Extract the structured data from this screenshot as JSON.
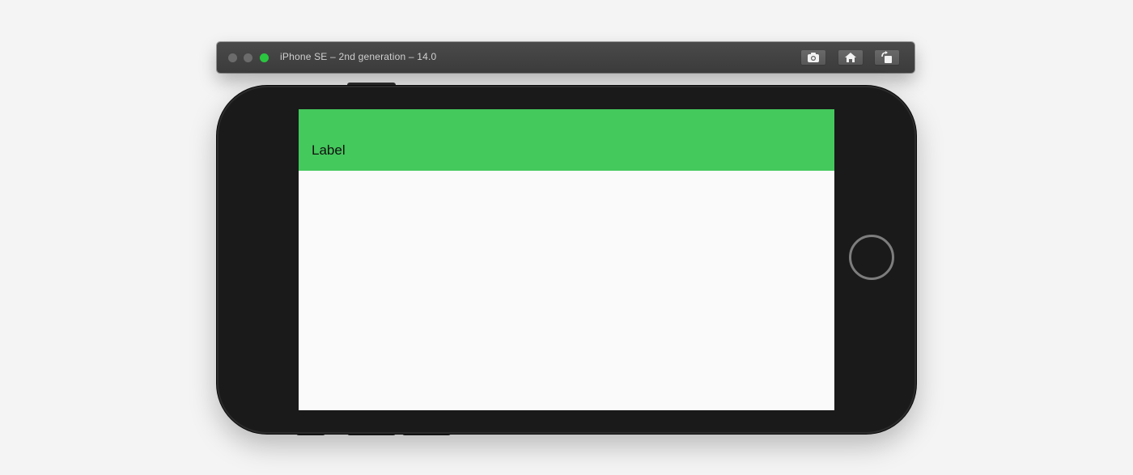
{
  "simulator": {
    "title": "iPhone SE – 2nd generation – 14.0",
    "buttons": {
      "screenshot_icon": "camera-icon",
      "home_icon": "home-icon",
      "rotate_icon": "rotate-icon"
    }
  },
  "app": {
    "header": {
      "label": "Label",
      "background_color": "#44c95c"
    },
    "content_background": "#fafafa"
  },
  "colors": {
    "traffic_zoom": "#2ac640",
    "traffic_inactive": "#6b6b6b",
    "device_body": "#1a1a1a"
  }
}
